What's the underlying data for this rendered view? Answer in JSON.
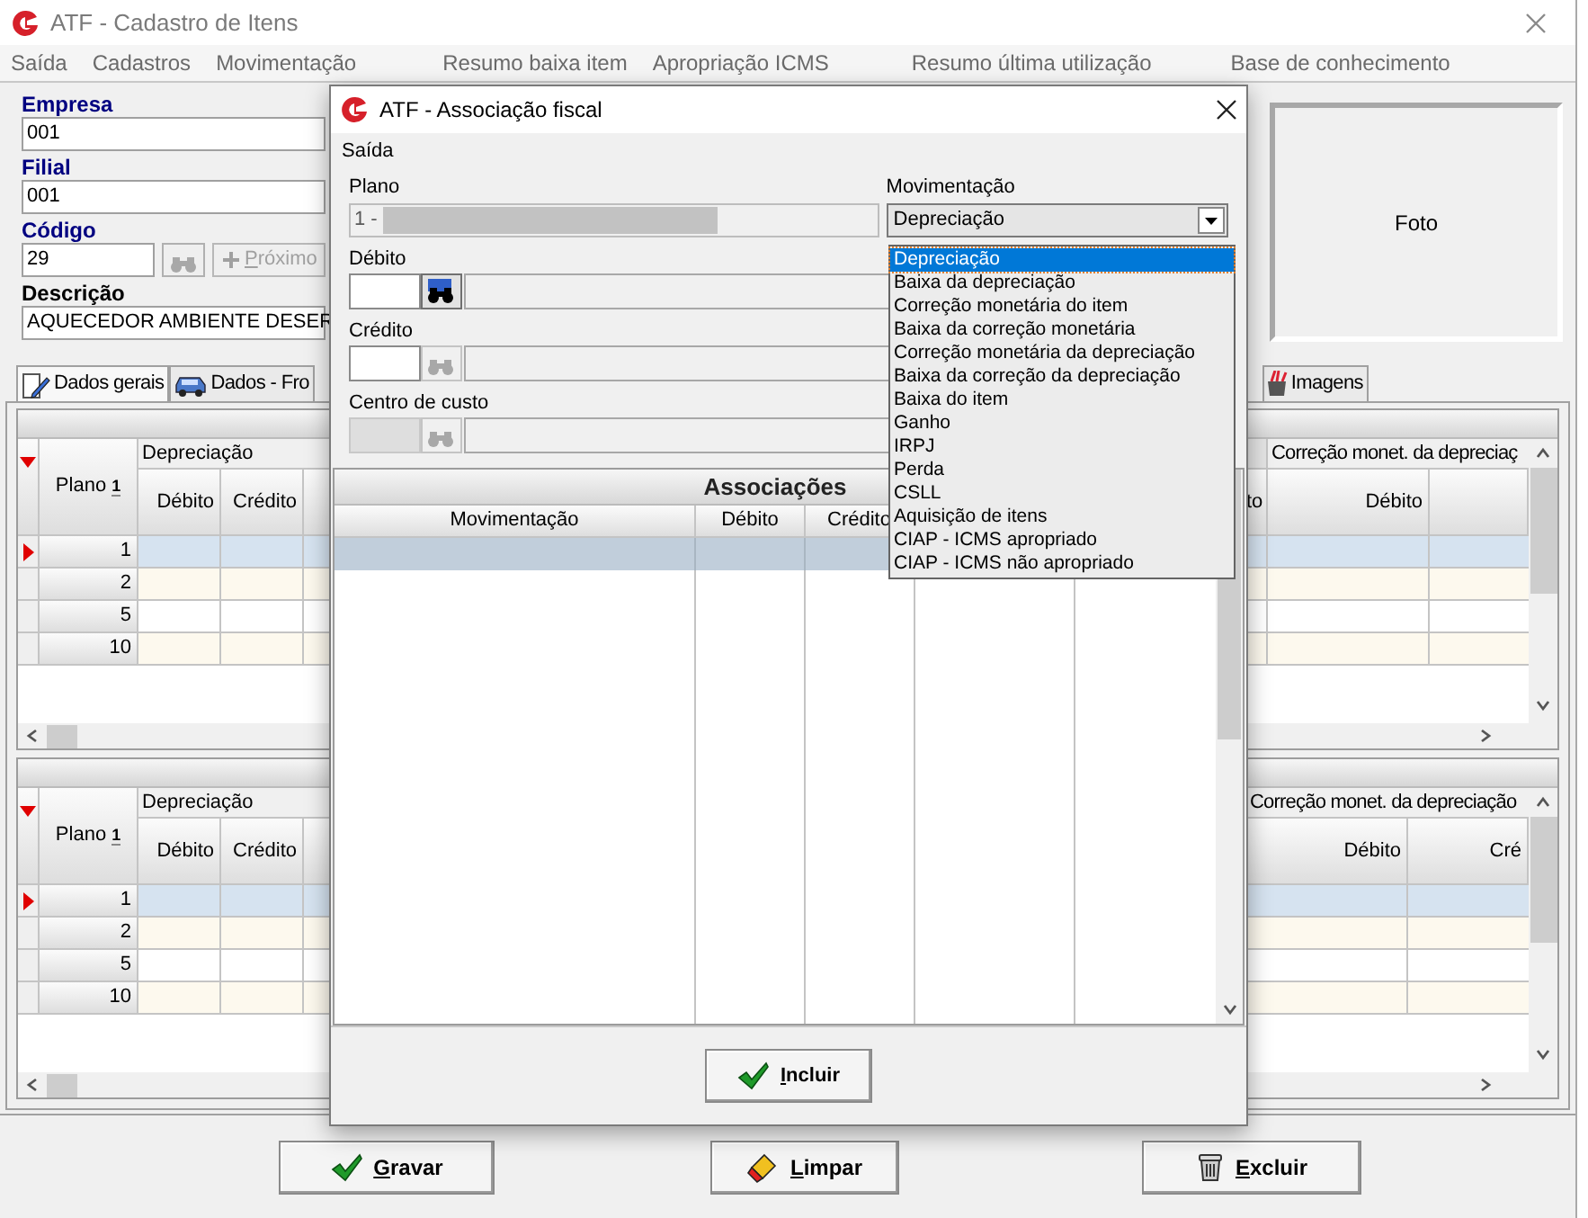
{
  "window": {
    "title": "ATF - Cadastro de Itens"
  },
  "menu": [
    "Saída",
    "Cadastros",
    "Movimentação",
    "Resumo baixa item",
    "Apropriação ICMS",
    "Resumo última utilização",
    "Base de conhecimento"
  ],
  "form": {
    "empresa": {
      "label": "Empresa",
      "value": "001"
    },
    "filial": {
      "label": "Filial",
      "value": "001"
    },
    "codigo": {
      "label": "Código",
      "value": "29"
    },
    "next_button": {
      "label": "Próximo",
      "disabled": true
    },
    "descricao": {
      "label": "Descrição",
      "value": "AQUECEDOR AMBIENTE DESER"
    }
  },
  "photo": {
    "label": "Foto"
  },
  "tabs": [
    {
      "label": "Dados gerais",
      "kind": "edit",
      "selected": true
    },
    {
      "label": "Dados - Fro",
      "kind": "car",
      "selected": false
    },
    {
      "label": "Imagens",
      "kind": "images",
      "selected": false
    }
  ],
  "grids": [
    {
      "plano_label": "Plano",
      "sort_order": "1",
      "left_group": "Depreciação",
      "left_columns": [
        "Débito",
        "Crédito"
      ],
      "partial_column": "to",
      "right_group": "Correção monet. da depreciaç",
      "right_columns": [
        "Débito"
      ],
      "rows": [
        {
          "plano": "1",
          "selected": true
        },
        {
          "plano": "2",
          "selected": false
        },
        {
          "plano": "5",
          "selected": false
        },
        {
          "plano": "10",
          "selected": false
        }
      ]
    },
    {
      "plano_label": "Plano",
      "sort_order": "1",
      "left_group": "Depreciação",
      "left_columns": [
        "Débito",
        "Crédito"
      ],
      "right_group": "Correção monet. da depreciação",
      "right_columns": [
        "Débito",
        "Cré"
      ],
      "rows": [
        {
          "plano": "1",
          "selected": true
        },
        {
          "plano": "2",
          "selected": false
        },
        {
          "plano": "5",
          "selected": false
        },
        {
          "plano": "10",
          "selected": false
        }
      ]
    }
  ],
  "buttons": [
    {
      "label": "Gravar",
      "kind": "save"
    },
    {
      "label": "Limpar",
      "kind": "clear"
    },
    {
      "label": "Excluir",
      "kind": "delete"
    }
  ],
  "dialog": {
    "title": "ATF - Associação fiscal",
    "menu": [
      "Saída"
    ],
    "plano": {
      "label": "Plano",
      "value": "1 -"
    },
    "movimentacao": {
      "label": "Movimentação",
      "value": "Depreciação",
      "expanded": true,
      "options": [
        {
          "label": "Depreciação",
          "selected": true
        },
        {
          "label": "Baixa da depreciação",
          "selected": false
        },
        {
          "label": "Correção monetária do item",
          "selected": false
        },
        {
          "label": "Baixa da correção monetária",
          "selected": false
        },
        {
          "label": "Correção monetária da depreciação",
          "selected": false
        },
        {
          "label": "Baixa da correção da depreciação",
          "selected": false
        },
        {
          "label": "Baixa do item",
          "selected": false
        },
        {
          "label": "Ganho",
          "selected": false
        },
        {
          "label": "IRPJ",
          "selected": false
        },
        {
          "label": "Perda",
          "selected": false
        },
        {
          "label": "CSLL",
          "selected": false
        },
        {
          "label": "Aquisição de itens",
          "selected": false
        },
        {
          "label": "CIAP - ICMS apropriado",
          "selected": false
        },
        {
          "label": "CIAP - ICMS não apropriado",
          "selected": false
        }
      ]
    },
    "lookups": [
      {
        "label": "Débito",
        "button_disabled": false,
        "field_disabled": false
      },
      {
        "label": "Crédito",
        "button_disabled": true,
        "field_disabled": false
      },
      {
        "label": "Centro de custo",
        "button_disabled": true,
        "field_disabled": true
      }
    ],
    "associacoes": {
      "title": "Associações",
      "columns": [
        "Movimentação",
        "Débito",
        "Crédito"
      ]
    },
    "button": "Incluir"
  }
}
